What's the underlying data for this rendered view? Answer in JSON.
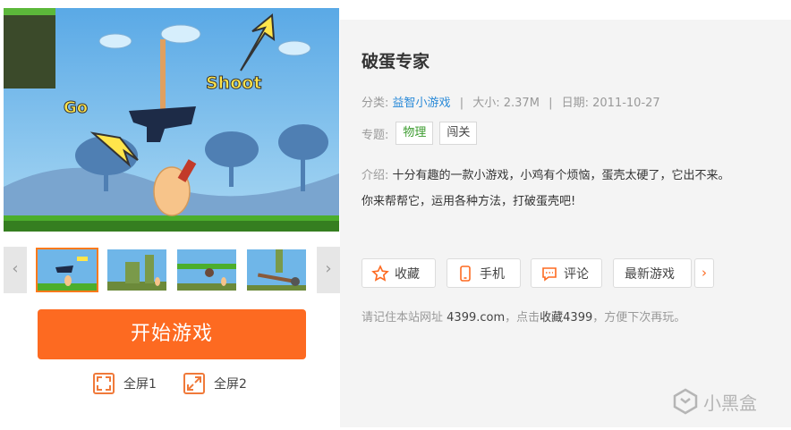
{
  "screenshot": {
    "label_go": "Go",
    "label_shoot": "Shoot"
  },
  "carousel": {
    "prev_icon": "chevron-left-icon",
    "next_icon": "chevron-right-icon",
    "active_index": 0
  },
  "start_button": "开始游戏",
  "fullscreen": [
    {
      "label": "全屏1",
      "icon": "fullscreen-icon"
    },
    {
      "label": "全屏2",
      "icon": "expand-icon"
    }
  ],
  "game": {
    "title": "破蛋专家",
    "category_label": "分类:",
    "category": "益智小游戏",
    "size_label": "大小:",
    "size": "2.37M",
    "date_label": "日期:",
    "date": "2011-10-27",
    "topic_label": "专题:",
    "topics": [
      "物理",
      "闯关"
    ],
    "intro_label": "介绍:",
    "intro_line1": "十分有趣的一款小游戏，小鸡有个烦恼，蛋壳太硬了，它出不来。",
    "intro_line2": "你来帮帮它，运用各种方法，打破蛋壳吧!"
  },
  "actions": {
    "favorite": "收藏",
    "mobile": "手机",
    "comment": "评论",
    "latest": "最新游戏",
    "more_icon": "chevron-right-icon"
  },
  "notice": {
    "prefix": "请记住本站网址",
    "site": "4399.com",
    "middle": "，点击",
    "fav": "收藏4399",
    "suffix": "，方便下次再玩。"
  },
  "watermark": "小黑盒",
  "colors": {
    "accent": "#fd6a21",
    "link": "#2a8ad8",
    "tag_green": "#3b9b2e",
    "sky": "#6fb6e8",
    "grass": "#4cae2c"
  }
}
